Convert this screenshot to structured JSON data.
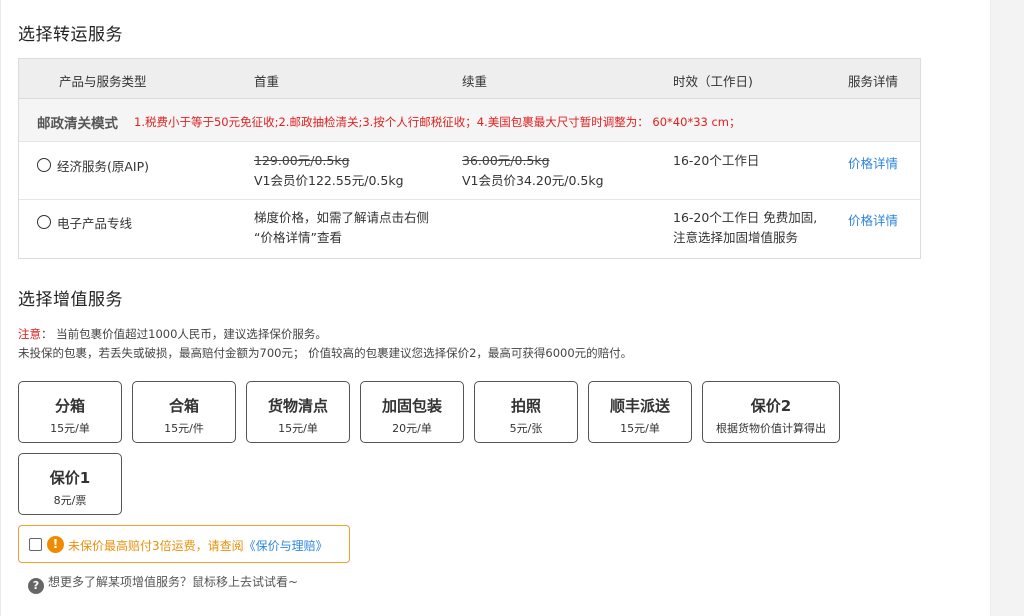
{
  "shipping": {
    "title": "选择转运服务",
    "columns": [
      "产品与服务类型",
      "首重",
      "续重",
      "时效（工作日)",
      "服务详情"
    ],
    "mode": {
      "title": "邮政清关模式",
      "note": "1.税费小于等于50元免征收;2.邮政抽检清关;3.按个人行邮税征收；4.美国包裹最大尺寸暂时调整为： 60*40*33 cm；"
    },
    "services": [
      {
        "name": "经济服务(原AIP)",
        "first_weight_strike": "129.00元/0.5kg",
        "first_weight_member": "V1会员价122.55元/0.5kg",
        "extra_weight_strike": "36.00元/0.5kg",
        "extra_weight_member": "V1会员价34.20元/0.5kg",
        "time_line1": "16-20个工作日",
        "time_line2": "",
        "detail": "价格详情"
      },
      {
        "name": "电子产品专线",
        "first_weight_strike": "",
        "first_weight_member": "",
        "price_note_line1": "梯度价格，如需了解请点击右侧",
        "price_note_line2": "“价格详情”查看",
        "time_line1": "16-20个工作日 免费加固,",
        "time_line2": "注意选择加固增值服务",
        "detail": "价格详情"
      }
    ]
  },
  "value_added": {
    "title": "选择增值服务",
    "notice_label": "注意",
    "notice_line1": "：  当前包裹价值超过1000人民币，建议选择保价服务。",
    "notice_line2": "未投保的包裹，若丢失或破损，最高赔付金额为700元；  价值较高的包裹建议您选择保价2，最高可获得6000元的赔付。",
    "addons": [
      {
        "name": "分箱",
        "price": "15元/单"
      },
      {
        "name": "合箱",
        "price": "15元/件"
      },
      {
        "name": "货物清点",
        "price": "15元/单"
      },
      {
        "name": "加固包装",
        "price": "20元/单"
      },
      {
        "name": "拍照",
        "price": "5元/张"
      },
      {
        "name": "顺丰派送",
        "price": "15元/单"
      },
      {
        "name": "保价2",
        "price": "根据货物价值计算得出"
      },
      {
        "name": "保价1",
        "price": "8元/票"
      }
    ],
    "insure_warning": "未保价最高赔付3倍运费，请查阅",
    "insure_link": "《保价与理赔》",
    "help_text": "想更多了解某项增值服务？鼠标移上去试试看~",
    "help_icon": "question-circle-icon",
    "warning_icon": "exclamation-circle-icon"
  },
  "colors": {
    "warning_red": "#e02020",
    "link_blue": "#2e86de",
    "warning_orange": "#f08a00"
  }
}
